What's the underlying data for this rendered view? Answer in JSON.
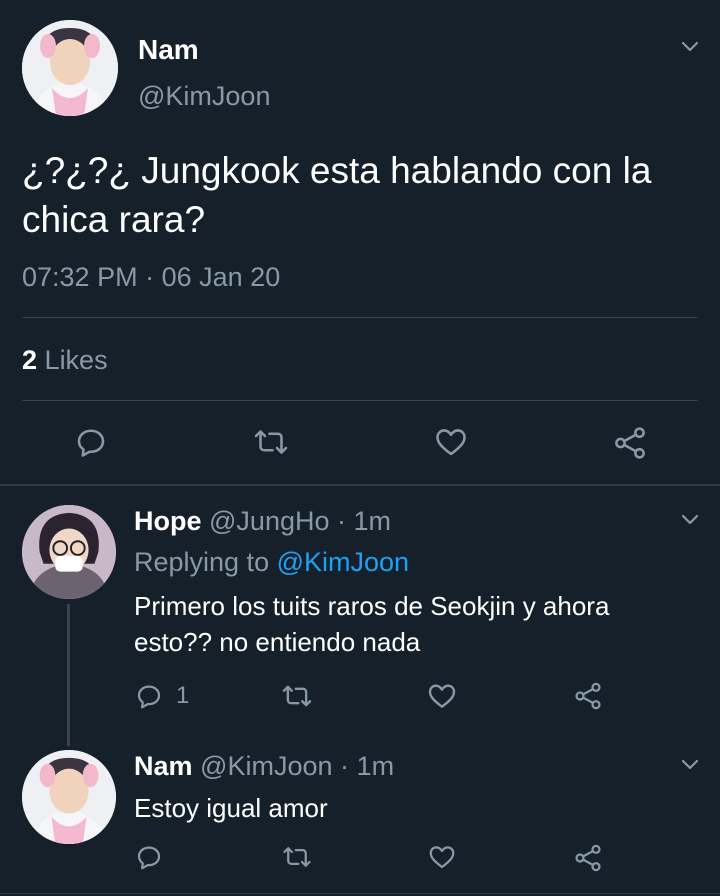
{
  "main_tweet": {
    "name": "Nam",
    "handle": "@KimJoon",
    "text": "¿?¿?¿ Jungkook esta hablando con la chica rara?",
    "time": "07:32 PM",
    "sep": "·",
    "date": "06 Jan 20",
    "likes_count": "2",
    "likes_label": "Likes"
  },
  "replies": [
    {
      "name": "Hope",
      "handle": "@JungHo",
      "sep": "·",
      "time": "1m",
      "replying_prefix": "Replying to",
      "replying_to": "@KimJoon",
      "text": "Primero los tuits raros de Seokjin y ahora esto?? no entiendo nada",
      "reply_count": "1"
    },
    {
      "name": "Nam",
      "handle": "@KimJoon",
      "sep": "·",
      "time": "1m",
      "text": "Estoy igual amor"
    }
  ],
  "colors": {
    "background": "#15202b",
    "muted": "#8899a6",
    "link": "#1da1f2",
    "divider": "#38444d"
  },
  "icons": [
    "chevron-down-icon",
    "reply-icon",
    "retweet-icon",
    "like-icon",
    "share-icon"
  ]
}
